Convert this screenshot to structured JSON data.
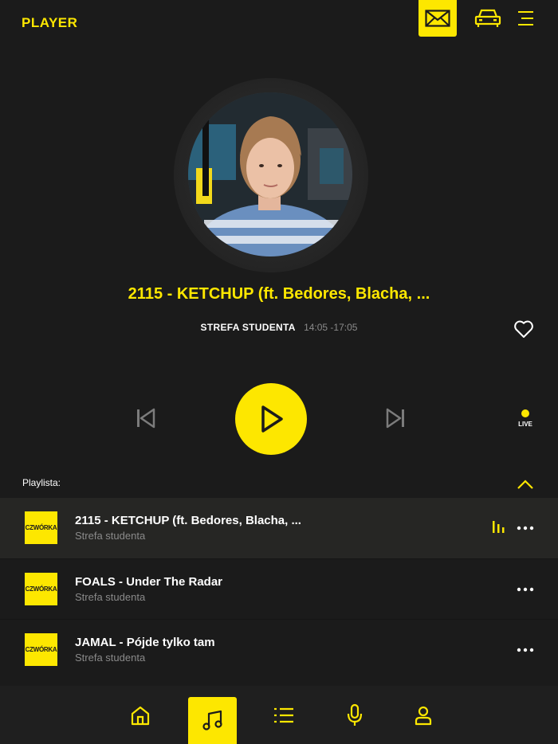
{
  "header": {
    "title": "PLAYER",
    "icons": [
      "mail-icon",
      "car-icon",
      "menu-icon"
    ]
  },
  "now_playing": {
    "title": "2115 - KETCHUP (ft. Bedores, Blacha, ...",
    "show_name": "STREFA STUDENTA",
    "show_time": "14:05 -17:05"
  },
  "controls": {
    "live_label": "LIVE"
  },
  "playlist": {
    "label": "Playlista:",
    "items": [
      {
        "title": "2115 - KETCHUP (ft. Bedores, Blacha, ...",
        "subtitle": "Strefa studenta",
        "thumb_text": "CZWÓRKA",
        "active": true
      },
      {
        "title": "FOALS - Under The Radar",
        "subtitle": "Strefa studenta",
        "thumb_text": "CZWÓRKA",
        "active": false
      },
      {
        "title": "JAMAL - Pójde tylko tam",
        "subtitle": "Strefa studenta",
        "thumb_text": "CZWÓRKA",
        "active": false
      }
    ]
  },
  "bottom_nav": {
    "items": [
      "home-icon",
      "music-note-icon",
      "list-icon",
      "microphone-icon",
      "user-icon"
    ],
    "active": "music-note-icon"
  },
  "colors": {
    "accent": "#fde700",
    "background": "#1b1b1b",
    "muted_text": "#8a8a8a"
  }
}
